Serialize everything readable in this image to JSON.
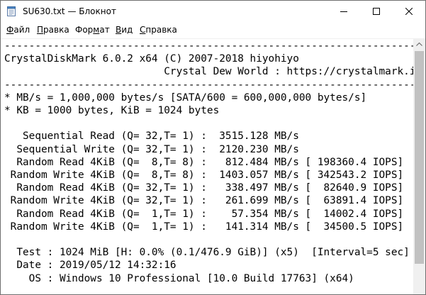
{
  "window": {
    "title": "SU630.txt — Блокнот"
  },
  "menu": {
    "file": {
      "first": "Ф",
      "rest": "айл"
    },
    "edit": {
      "first": "П",
      "rest": "равка"
    },
    "format": {
      "first": "",
      "hot": "Ф",
      "before": "",
      "after": "ормат"
    },
    "view": {
      "first": "В",
      "rest": "ид"
    },
    "help": {
      "first": "С",
      "rest": "правка"
    }
  },
  "menu_labels": {
    "file_a": "Ф",
    "file_b": "айл",
    "edit_a": "П",
    "edit_b": "равка",
    "format_a": "Фор",
    "format_b": "м",
    "format_c": "ат",
    "view_a": "В",
    "view_b": "ид",
    "help_a": "С",
    "help_b": "правка"
  },
  "content": {
    "lines": [
      "-----------------------------------------------------------------------",
      "CrystalDiskMark 6.0.2 x64 (C) 2007-2018 hiyohiyo",
      "                          Crystal Dew World : https://crystalmark.info/",
      "-----------------------------------------------------------------------",
      "* MB/s = 1,000,000 bytes/s [SATA/600 = 600,000,000 bytes/s]",
      "* KB = 1000 bytes, KiB = 1024 bytes",
      "",
      "   Sequential Read (Q= 32,T= 1) :  3515.128 MB/s",
      "  Sequential Write (Q= 32,T= 1) :  2120.230 MB/s",
      "  Random Read 4KiB (Q=  8,T= 8) :   812.484 MB/s [ 198360.4 IOPS]",
      " Random Write 4KiB (Q=  8,T= 8) :  1403.057 MB/s [ 342543.2 IOPS]",
      "  Random Read 4KiB (Q= 32,T= 1) :   338.497 MB/s [  82640.9 IOPS]",
      " Random Write 4KiB (Q= 32,T= 1) :   261.699 MB/s [  63891.4 IOPS]",
      "  Random Read 4KiB (Q=  1,T= 1) :    57.354 MB/s [  14002.4 IOPS]",
      " Random Write 4KiB (Q=  1,T= 1) :   141.314 MB/s [  34500.5 IOPS]",
      "",
      "  Test : 1024 MiB [H: 0.0% (0.1/476.9 GiB)] (x5)  [Interval=5 sec]",
      "  Date : 2019/05/12 14:32:16",
      "    OS : Windows 10 Professional [10.0 Build 17763] (x64)"
    ]
  },
  "icons": {
    "app": "notepad-icon",
    "minimize": "minimize-icon",
    "maximize": "maximize-icon",
    "close": "close-icon",
    "scroll_up": "chevron-up-icon"
  },
  "colors": {
    "scrollbar_track": "#f0f0f0",
    "scrollbar_thumb": "#c1c1c1"
  }
}
